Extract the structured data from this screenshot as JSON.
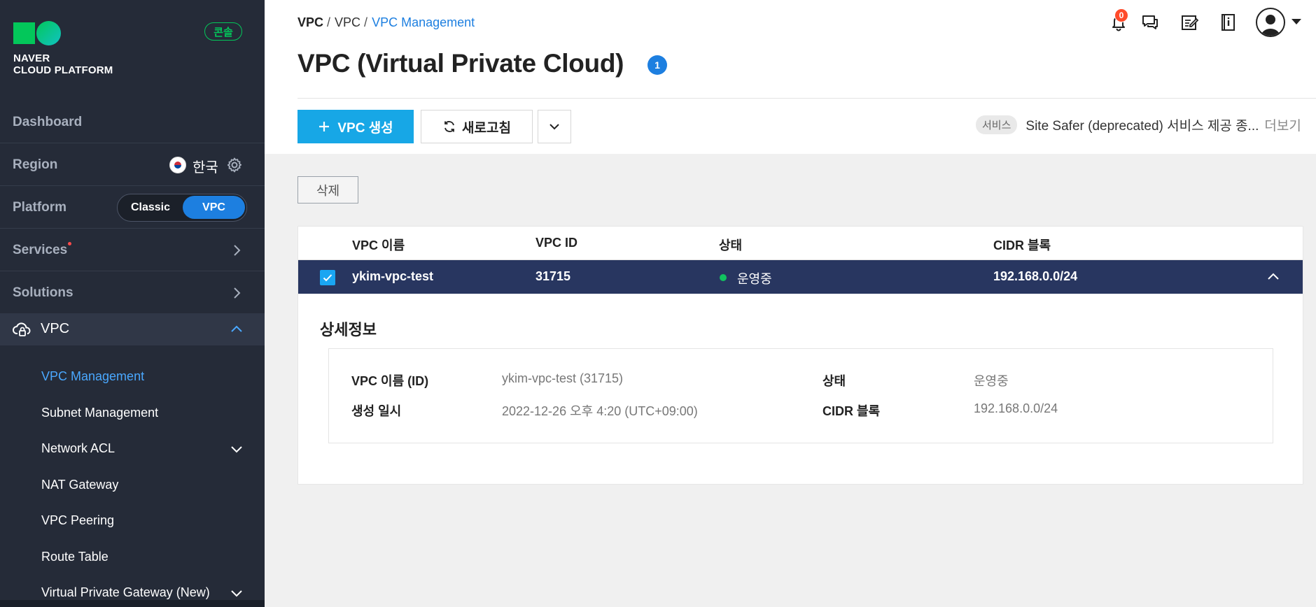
{
  "sidebar": {
    "logo_line1": "NAVER",
    "logo_line2": "CLOUD PLATFORM",
    "console_badge": "콘솔",
    "dashboard": "Dashboard",
    "region": {
      "label": "Region",
      "value": "한국"
    },
    "platform": {
      "label": "Platform",
      "options": [
        "Classic",
        "VPC"
      ],
      "selected": "VPC"
    },
    "services": "Services",
    "solutions": "Solutions",
    "vpc_section": "VPC",
    "items": [
      {
        "label": "VPC Management",
        "active": true
      },
      {
        "label": "Subnet Management"
      },
      {
        "label": "Network ACL",
        "expandable": true
      },
      {
        "label": "NAT Gateway"
      },
      {
        "label": "VPC Peering"
      },
      {
        "label": "Route Table"
      },
      {
        "label": "Virtual Private Gateway (New)",
        "expandable": true
      }
    ]
  },
  "header": {
    "breadcrumb": [
      "VPC",
      "VPC",
      "VPC Management"
    ],
    "breadcrumb_sep": "/",
    "title": "VPC (Virtual Private Cloud)",
    "title_badge": "1",
    "notification_count": "0"
  },
  "toolbar": {
    "create_label": "VPC 생성",
    "refresh_label": "새로고침",
    "notice_tag": "서비스",
    "notice_text": "Site Safer (deprecated) 서비스 제공 종...",
    "notice_more": "더보기"
  },
  "actions": {
    "delete_label": "삭제"
  },
  "table": {
    "columns": [
      "VPC 이름",
      "VPC ID",
      "상태",
      "CIDR 블록"
    ],
    "rows": [
      {
        "name": "ykim-vpc-test",
        "id": "31715",
        "status": "운영중",
        "cidr": "192.168.0.0/24",
        "selected": true
      }
    ]
  },
  "detail": {
    "title": "상세정보",
    "fields": {
      "name_label": "VPC 이름 (ID)",
      "name_value": "ykim-vpc-test (31715)",
      "status_label": "상태",
      "status_value": "운영중",
      "created_label": "생성 일시",
      "created_value": "2022-12-26 오후 4:20 (UTC+09:00)",
      "cidr_label": "CIDR 블록",
      "cidr_value": "192.168.0.0/24"
    }
  },
  "colors": {
    "sidebar_bg": "#252b38",
    "accent_blue": "#1d7fe0",
    "create_button": "#17a7e6",
    "selected_row": "#283660",
    "status_running": "#11c35f",
    "brand_green": "#03c75a"
  }
}
